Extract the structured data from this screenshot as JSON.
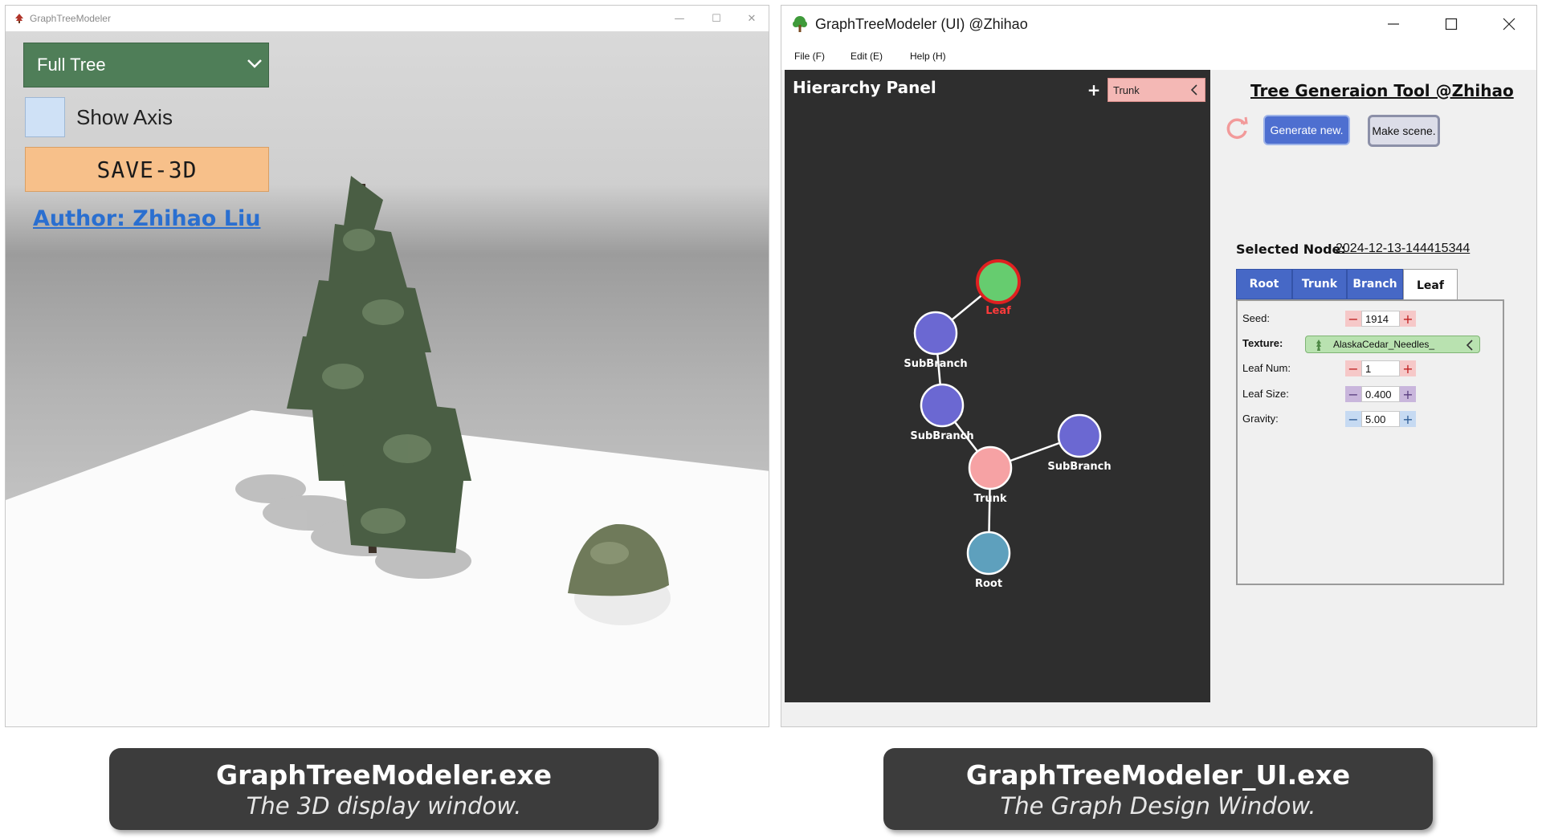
{
  "left_window": {
    "title": "GraphTreeModeler",
    "mode_select": "Full Tree",
    "show_axis_label": "Show Axis",
    "save_button": "SAVE-3D",
    "author_link": "Author: Zhihao Liu"
  },
  "right_window": {
    "title": "GraphTreeModeler (UI)  @Zhihao",
    "menu": [
      "File (F)",
      "Edit (E)",
      "Help (H)"
    ],
    "hierarchy_panel": {
      "title": "Hierarchy Panel",
      "add_symbol": "+",
      "node_type_select": "Trunk",
      "nodes": [
        {
          "label": "Leaf",
          "color": "#66cc6f",
          "selected": true
        },
        {
          "label": "SubBranch",
          "color": "#6b68d2"
        },
        {
          "label": "SubBranch",
          "color": "#6b68d2"
        },
        {
          "label": "SubBranch",
          "color": "#6b68d2"
        },
        {
          "label": "Trunk",
          "color": "#f6a2a4"
        },
        {
          "label": "Root",
          "color": "#5ea0bd"
        }
      ]
    },
    "tool_title": "Tree Generaion Tool @Zhihao",
    "generate_button": "Generate new.",
    "make_scene_button": "Make scene.",
    "selected_node_label": "Selected Node:",
    "selected_node_value": "2024-12-13-144415344",
    "tabs": [
      "Root",
      "Trunk",
      "Branch",
      "Leaf"
    ],
    "active_tab": "Leaf",
    "properties": {
      "seed_label": "Seed:",
      "seed_value": "1914",
      "texture_label": "Texture:",
      "texture_value": "AlaskaCedar_Needles_",
      "leaf_num_label": "Leaf Num:",
      "leaf_num_value": "1",
      "leaf_size_label": "Leaf Size:",
      "leaf_size_value": "0.400",
      "gravity_label": "Gravity:",
      "gravity_value": "5.00"
    }
  },
  "captions": [
    {
      "title": "GraphTreeModeler.exe",
      "subtitle": "The 3D display window."
    },
    {
      "title": "GraphTreeModeler_UI.exe",
      "subtitle": "The Graph Design Window."
    }
  ],
  "colors": {
    "mode_select_bg": "#4f7e58",
    "save_button_bg": "#f7c08a",
    "link": "#2a6fd0",
    "hierarchy_bg": "#2e2e2e",
    "tab_blue": "#4668c6",
    "selected_ring": "#e02020"
  }
}
